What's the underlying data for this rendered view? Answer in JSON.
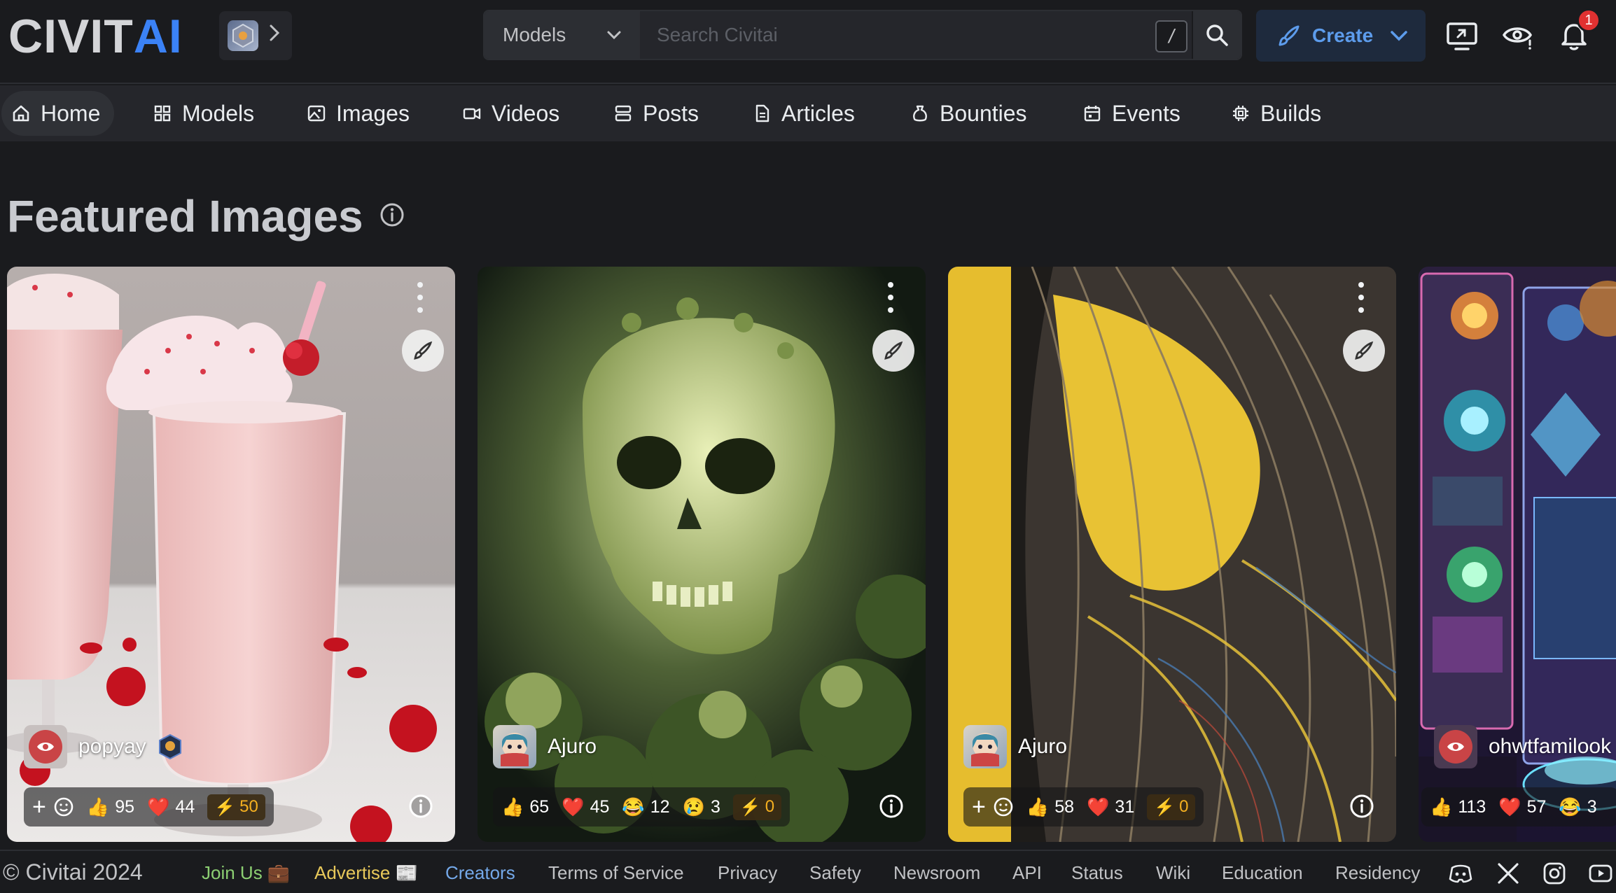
{
  "header": {
    "logo_left": "CIVIT",
    "logo_right": "AI",
    "search_type": "Models",
    "search_placeholder": "Search Civitai",
    "search_hotkey": "/",
    "create_label": "Create",
    "notification_count": "1"
  },
  "nav": [
    {
      "label": "Home",
      "icon": "home-icon"
    },
    {
      "label": "Models",
      "icon": "grid-icon"
    },
    {
      "label": "Images",
      "icon": "image-icon"
    },
    {
      "label": "Videos",
      "icon": "video-icon"
    },
    {
      "label": "Posts",
      "icon": "posts-icon"
    },
    {
      "label": "Articles",
      "icon": "file-icon"
    },
    {
      "label": "Bounties",
      "icon": "moneybag-icon"
    },
    {
      "label": "Events",
      "icon": "calendar-icon"
    },
    {
      "label": "Builds",
      "icon": "cpu-icon"
    }
  ],
  "section": {
    "title": "Featured Images"
  },
  "cards": [
    {
      "username": "popyay",
      "likes": "95",
      "hearts": "44",
      "buzz": "50"
    },
    {
      "username": "Ajuro",
      "likes": "65",
      "hearts": "45",
      "laughs": "12",
      "cries": "3",
      "buzz": "0"
    },
    {
      "username": "Ajuro",
      "likes": "58",
      "hearts": "31",
      "buzz": "0"
    },
    {
      "username": "ohwtfamilook",
      "likes": "113",
      "hearts": "57",
      "laughs": "3"
    }
  ],
  "footer": {
    "copyright": "© Civitai 2024",
    "join": "Join Us 💼",
    "advertise": "Advertise 📰",
    "creators": "Creators",
    "terms": "Terms of Service",
    "privacy": "Privacy",
    "safety": "Safety",
    "newsroom": "Newsroom",
    "api": "API",
    "status": "Status",
    "wiki": "Wiki",
    "education": "Education",
    "residency": "Residency"
  },
  "colors": {
    "accent": "#3b82f6",
    "buzz": "#f5b020",
    "badge": "#e03131"
  }
}
